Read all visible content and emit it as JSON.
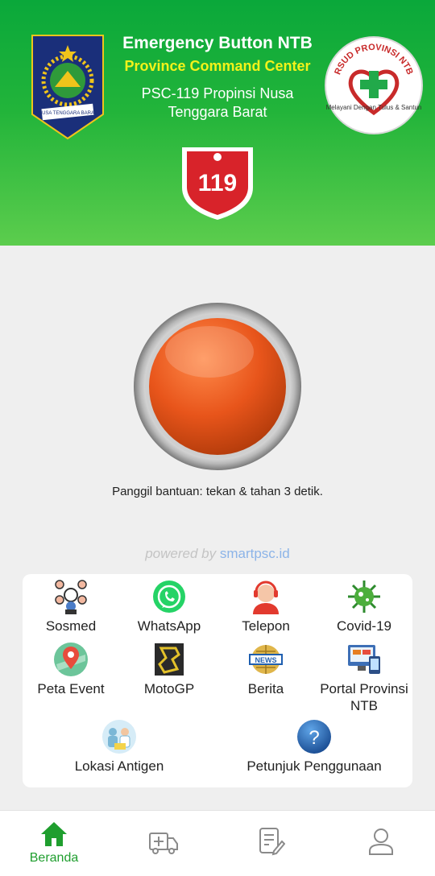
{
  "header": {
    "title": "Emergency Button NTB",
    "subtitle": "Province Command Center",
    "description": "PSC-119 Propinsi Nusa Tenggara Barat",
    "logo_ntb_text": "NUSA TENGGARA BARAT",
    "logo_rsud_arc": "RSUD PROVINSI NTB",
    "logo_rsud_motto": "Melayani Dengan Tulus & Santun",
    "logo_119_number": "119"
  },
  "emergency": {
    "hint": "Panggil bantuan: tekan & tahan 3 detik.",
    "button_color": "#e8551b"
  },
  "powered": {
    "prefix": "powered by",
    "site": "smartpsc.id"
  },
  "menu": {
    "sosmed": "Sosmed",
    "whatsapp": "WhatsApp",
    "telepon": "Telepon",
    "covid": "Covid-19",
    "peta_event": "Peta Event",
    "motogp": "MotoGP",
    "berita": "Berita",
    "portal": "Portal Provinsi NTB",
    "lokasi_antigen": "Lokasi Antigen",
    "petunjuk": "Petunjuk Penggunaan",
    "berita_badge": "NEWS",
    "petunjuk_icon_text": "?"
  },
  "nav": {
    "beranda": "Beranda",
    "active_color": "#1f9e2e"
  },
  "icons": [
    "sosmed-icon",
    "whatsapp-icon",
    "telepon-icon",
    "covid-icon",
    "map-pin-icon",
    "motogp-icon",
    "news-icon",
    "portal-icon",
    "antigen-icon",
    "help-icon",
    "home-icon",
    "ambulance-icon",
    "document-icon",
    "profile-icon"
  ]
}
